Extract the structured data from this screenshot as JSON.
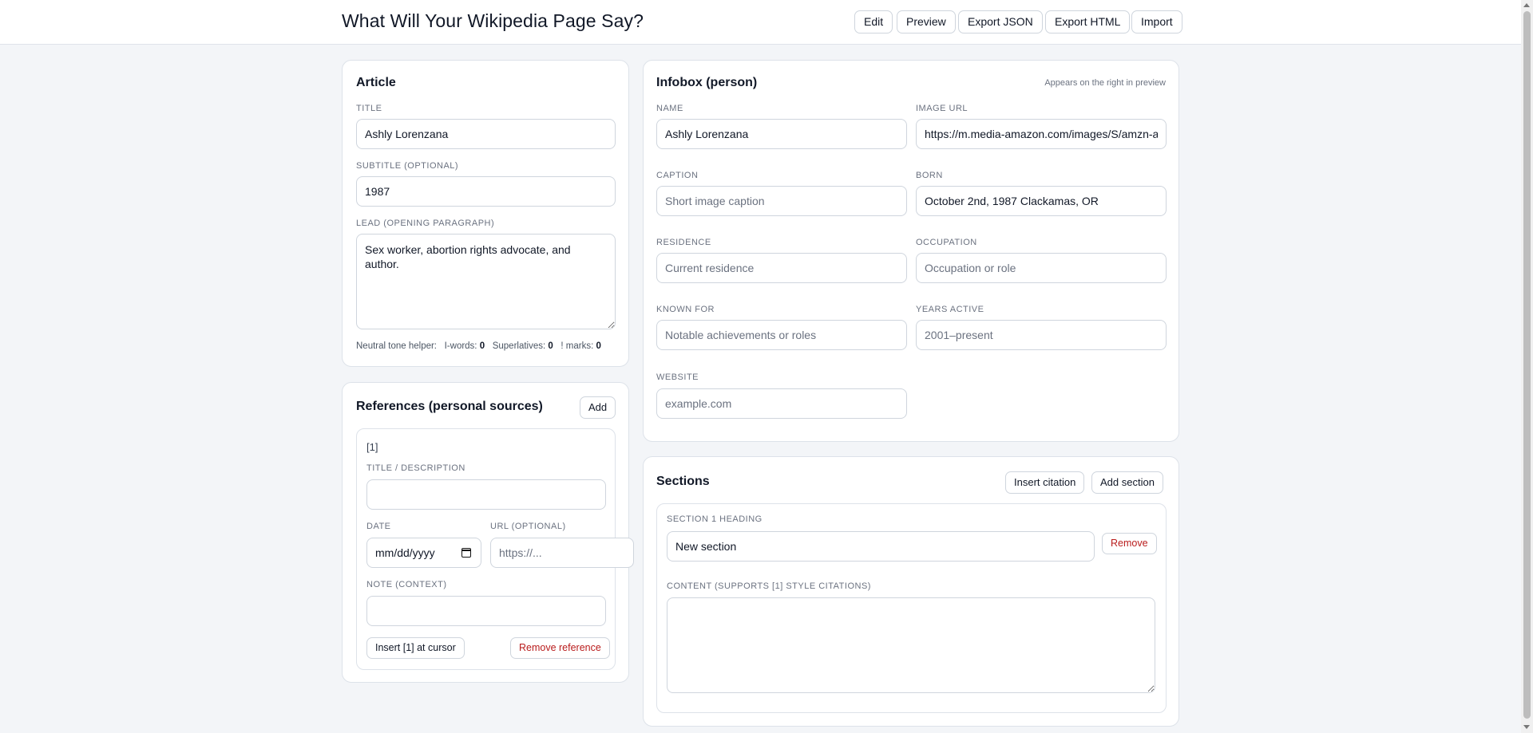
{
  "header": {
    "title": "What Will Your Wikipedia Page Say?",
    "buttons": {
      "edit": "Edit",
      "preview": "Preview",
      "export_json": "Export JSON",
      "export_html": "Export HTML",
      "import": "Import"
    }
  },
  "article": {
    "heading": "Article",
    "title_label": "TITLE",
    "title_value": "Ashly Lorenzana",
    "subtitle_label": "SUBTITLE (OPTIONAL)",
    "subtitle_value": "1987",
    "lead_label": "LEAD (OPENING PARAGRAPH)",
    "lead_value": "Sex worker, abortion rights advocate, and author.",
    "helper": {
      "prefix": "Neutral tone helper:",
      "iwords_label": "I-words:",
      "iwords_count": "0",
      "superlatives_label": "Superlatives:",
      "superlatives_count": "0",
      "marks_label": "! marks:",
      "marks_count": "0"
    }
  },
  "references": {
    "heading": "References (personal sources)",
    "add_label": "Add",
    "items": [
      {
        "number": "[1]",
        "title_label": "TITLE / DESCRIPTION",
        "title_value": "",
        "date_label": "DATE",
        "date_placeholder": "mm/dd/yyyy",
        "url_label": "URL (OPTIONAL)",
        "url_placeholder": "https://...",
        "note_label": "NOTE (CONTEXT)",
        "note_value": "",
        "insert_label": "Insert [1] at cursor",
        "remove_label": "Remove reference"
      }
    ]
  },
  "infobox": {
    "heading": "Infobox (person)",
    "hint": "Appears on the right in preview",
    "name_label": "NAME",
    "name_value": "Ashly Lorenzana",
    "image_label": "IMAGE URL",
    "image_value": "https://m.media-amazon.com/images/S/amzn-author-media-prod/",
    "caption_label": "CAPTION",
    "caption_placeholder": "Short image caption",
    "born_label": "BORN",
    "born_value": "October 2nd, 1987 Clackamas, OR",
    "residence_label": "RESIDENCE",
    "residence_placeholder": "Current residence",
    "occupation_label": "OCCUPATION",
    "occupation_placeholder": "Occupation or role",
    "known_label": "KNOWN FOR",
    "known_placeholder": "Notable achievements or roles",
    "years_label": "YEARS ACTIVE",
    "years_placeholder": "2001–present",
    "website_label": "WEBSITE",
    "website_placeholder": "example.com"
  },
  "sections": {
    "heading": "Sections",
    "insert_citation_label": "Insert citation",
    "add_section_label": "Add section",
    "items": [
      {
        "heading_label": "SECTION 1 HEADING",
        "heading_value": "New section",
        "remove_label": "Remove",
        "content_label": "CONTENT (SUPPORTS [1] STYLE CITATIONS)",
        "content_value": ""
      }
    ]
  },
  "colors": {
    "page_bg": "#f3f5f8",
    "danger": "#b91c1c",
    "border": "#dde2e9"
  }
}
